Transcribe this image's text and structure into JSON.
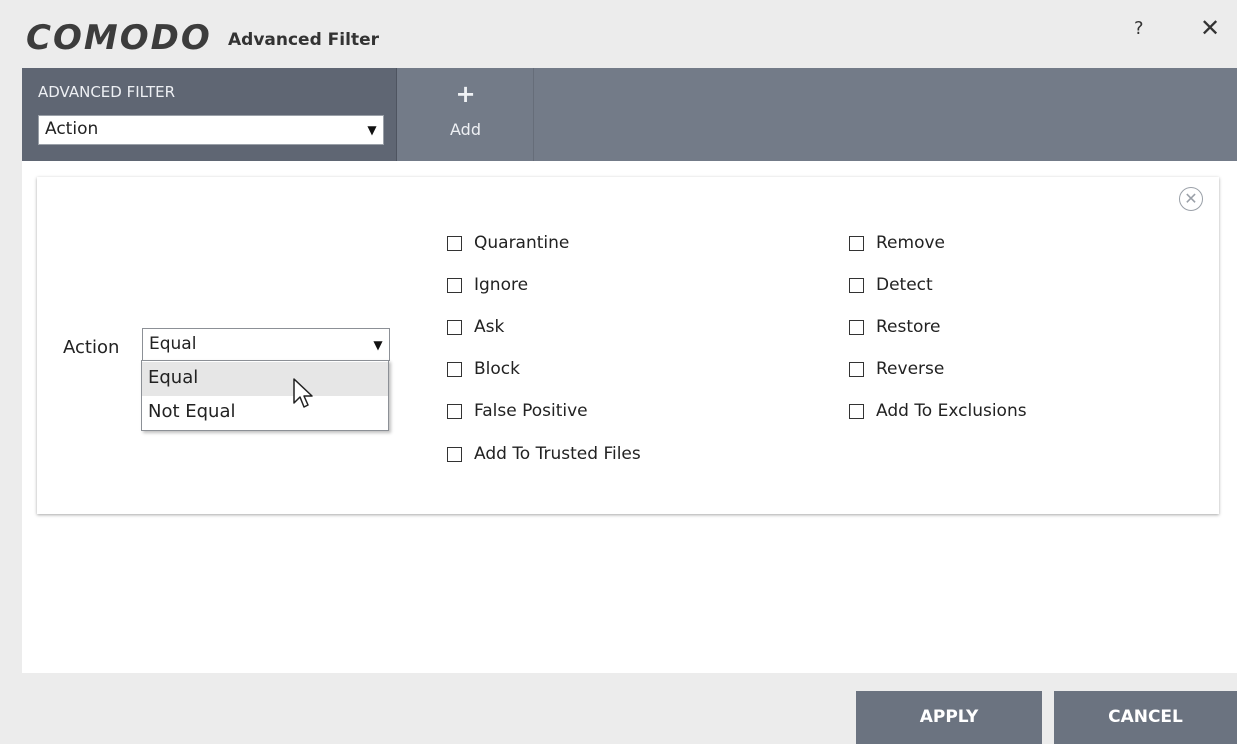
{
  "window": {
    "brand": "COMODO",
    "title": "Advanced Filter",
    "help_label": "?",
    "close_label": "✕"
  },
  "toolbar": {
    "heading": "ADVANCED FILTER",
    "filter_select_value": "Action",
    "add_icon": "+",
    "add_label": "Add"
  },
  "condition": {
    "field_label": "Action",
    "operator_value": "Equal",
    "operator_options": [
      "Equal",
      "Not Equal"
    ],
    "hovered_option": "Equal"
  },
  "actions_left": [
    {
      "label": "Quarantine",
      "checked": false
    },
    {
      "label": "Ignore",
      "checked": false
    },
    {
      "label": "Ask",
      "checked": false
    },
    {
      "label": "Block",
      "checked": false
    },
    {
      "label": "False Positive",
      "checked": false
    },
    {
      "label": "Add To Trusted Files",
      "checked": false
    }
  ],
  "actions_right": [
    {
      "label": "Remove",
      "checked": false
    },
    {
      "label": "Detect",
      "checked": false
    },
    {
      "label": "Restore",
      "checked": false
    },
    {
      "label": "Reverse",
      "checked": false
    },
    {
      "label": "Add To Exclusions",
      "checked": false
    }
  ],
  "footer": {
    "apply_label": "APPLY",
    "cancel_label": "CANCEL"
  },
  "colors": {
    "toolbar_bg": "#737b88",
    "toolbar_panel_bg": "#5f6673",
    "button_bg": "#6b7380"
  }
}
